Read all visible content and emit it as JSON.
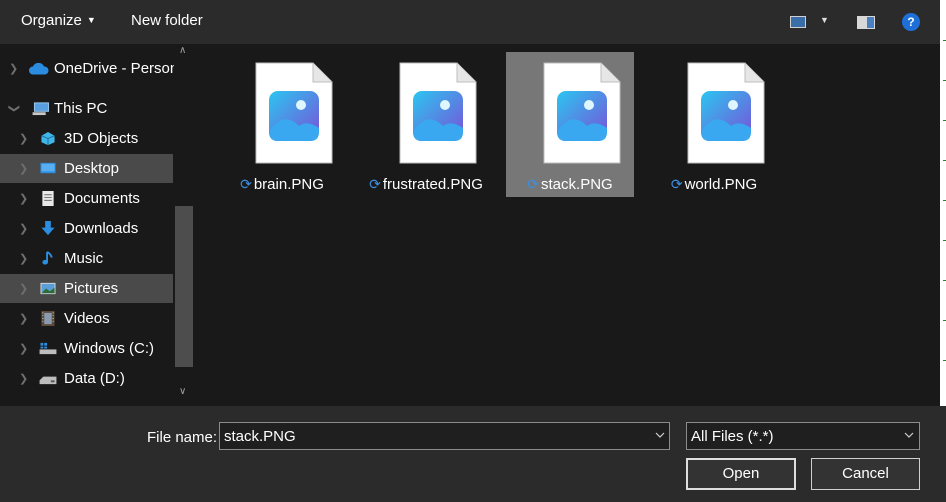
{
  "toolbar": {
    "organize_label": "Organize",
    "new_folder_label": "New folder",
    "help_label": "?"
  },
  "nav": {
    "items": [
      {
        "label": "OneDrive - Person",
        "icon": "onedrive-icon"
      },
      {
        "label": "This PC",
        "icon": "this-pc-icon"
      },
      {
        "label": "3D Objects",
        "icon": "3d-objects-icon"
      },
      {
        "label": "Desktop",
        "icon": "desktop-icon"
      },
      {
        "label": "Documents",
        "icon": "documents-icon"
      },
      {
        "label": "Downloads",
        "icon": "downloads-icon"
      },
      {
        "label": "Music",
        "icon": "music-icon"
      },
      {
        "label": "Pictures",
        "icon": "pictures-icon"
      },
      {
        "label": "Videos",
        "icon": "videos-icon"
      },
      {
        "label": "Windows (C:)",
        "icon": "drive-c-icon"
      },
      {
        "label": "Data (D:)",
        "icon": "drive-d-icon"
      }
    ]
  },
  "files": [
    {
      "name": "brain.PNG"
    },
    {
      "name": "frustrated.PNG"
    },
    {
      "name": "stack.PNG"
    },
    {
      "name": "world.PNG"
    }
  ],
  "footer": {
    "file_name_label": "File name:",
    "file_name_value": "stack.PNG",
    "file_type_value": "All Files (*.*)",
    "open_label": "Open",
    "cancel_label": "Cancel"
  },
  "colors": {
    "background": "#191919",
    "toolbar": "#2b2b2b",
    "selection": "#777777",
    "nav_selection": "#4a4a4a",
    "sync_icon": "#3c8fe0"
  }
}
